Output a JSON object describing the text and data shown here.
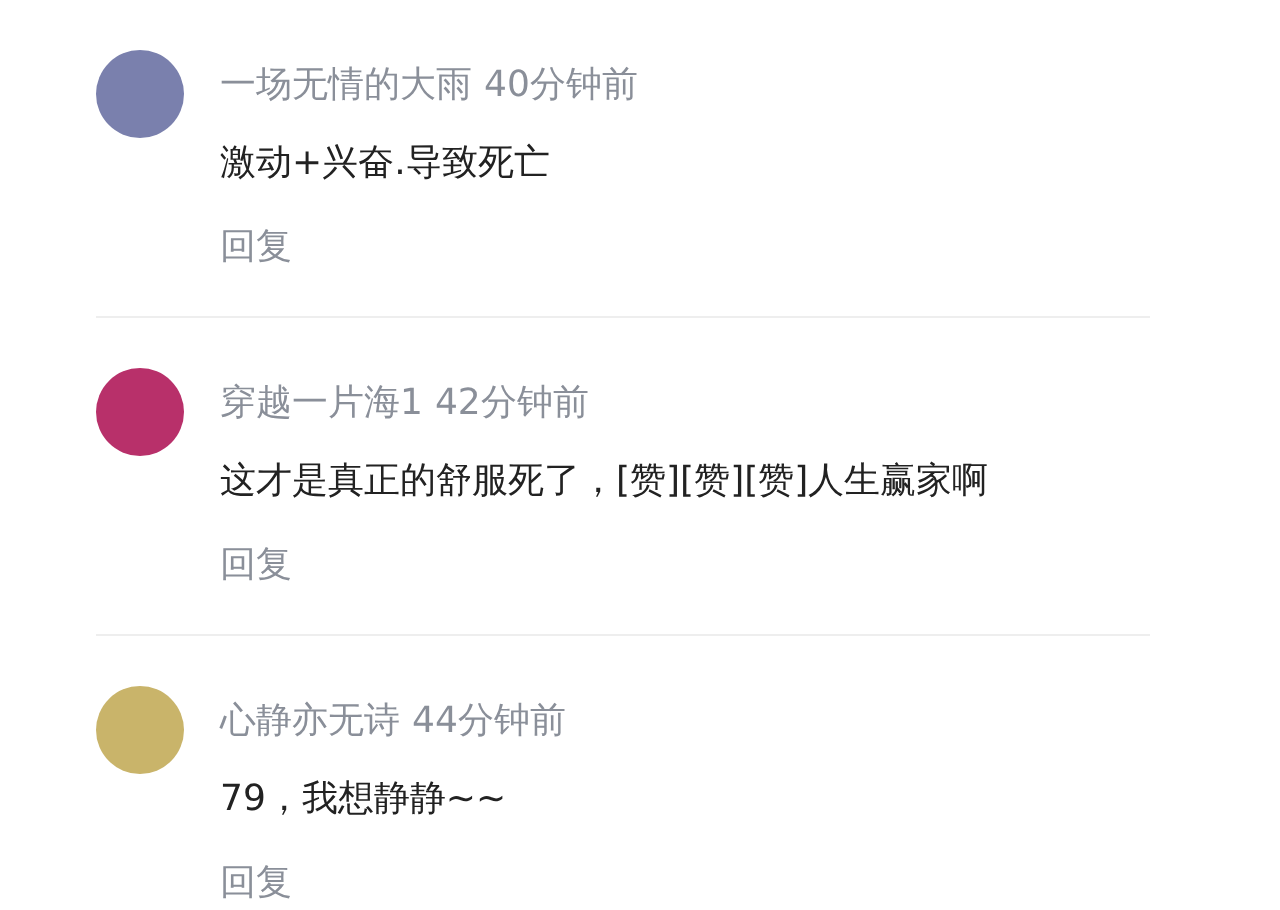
{
  "comments": [
    {
      "avatar": {
        "color": "#7a80ad"
      },
      "username": "一场无情的大雨",
      "time": "40分钟前",
      "text": "激动+兴奋.导致死亡",
      "reply": "回复"
    },
    {
      "avatar": {
        "color": "#b8306a"
      },
      "username": "穿越一片海1",
      "time": "42分钟前",
      "text": "这才是真正的舒服死了，[赞][赞][赞]人生赢家啊",
      "reply": "回复"
    },
    {
      "avatar": {
        "color": "#c9b46a"
      },
      "username": "心静亦无诗",
      "time": "44分钟前",
      "text": "79，我想静静~~",
      "reply": "回复"
    }
  ]
}
